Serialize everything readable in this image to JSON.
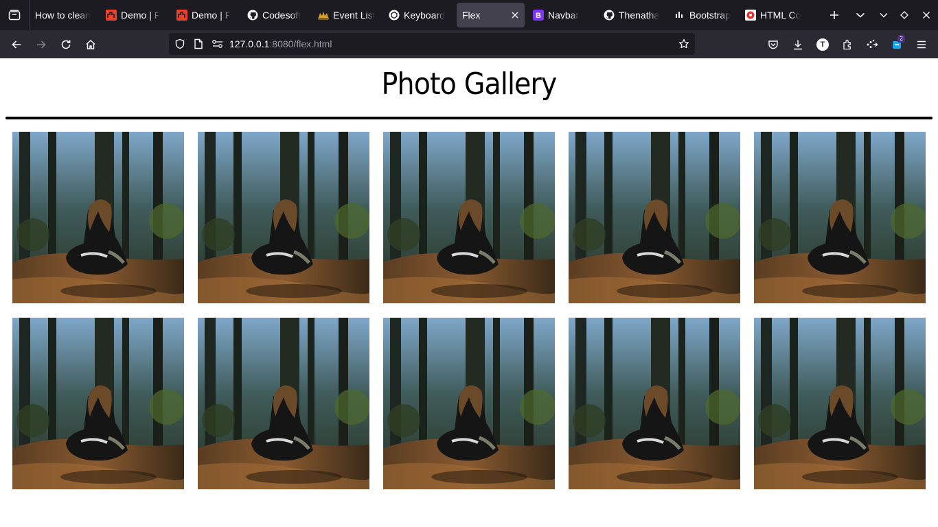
{
  "browser": {
    "tabs": [
      {
        "title": "How to clean",
        "favicon": "none"
      },
      {
        "title": "Demo | F",
        "favicon": "demo-icon"
      },
      {
        "title": "Demo | F",
        "favicon": "demo-icon"
      },
      {
        "title": "Codesoft",
        "favicon": "github-icon"
      },
      {
        "title": "Event List",
        "favicon": "crown-icon"
      },
      {
        "title": "Keyboard",
        "favicon": "openai-icon"
      },
      {
        "title": "Flex",
        "favicon": "none",
        "active": true
      },
      {
        "title": "Navbar",
        "favicon": "bootstrap-icon"
      },
      {
        "title": "Thenatha",
        "favicon": "github-icon"
      },
      {
        "title": "Bootstrap",
        "favicon": "bars-icon"
      },
      {
        "title": "HTML Co",
        "favicon": "red-circle-icon"
      }
    ],
    "url": {
      "host": "127.0.0.1",
      "rest": ":8080/flex.html"
    },
    "extension_badge": "2",
    "profile_initial": "T",
    "colors": {
      "tabbar": "#1c1b22",
      "navbar": "#2b2a33",
      "active_tab": "#42414d",
      "urlbar": "#1c1b22"
    }
  },
  "page": {
    "title": "Photo Gallery",
    "photos": [
      {
        "alt": ""
      },
      {
        "alt": ""
      },
      {
        "alt": ""
      },
      {
        "alt": ""
      },
      {
        "alt": ""
      },
      {
        "alt": ""
      },
      {
        "alt": ""
      },
      {
        "alt": ""
      },
      {
        "alt": ""
      },
      {
        "alt": ""
      }
    ]
  }
}
